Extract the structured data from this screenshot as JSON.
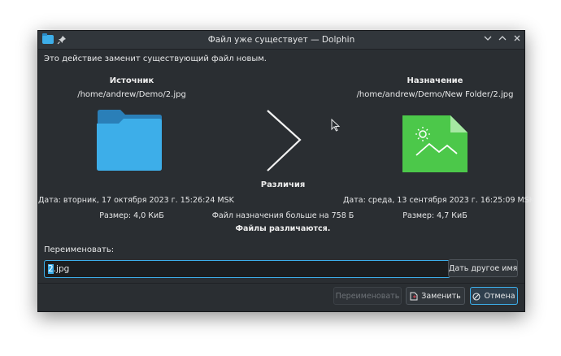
{
  "window": {
    "title": "Файл уже существует — Dolphin",
    "min_icon": "∨",
    "max_icon": "∧",
    "close_icon": "✕",
    "pin_icon": "pin-icon"
  },
  "description": "Это действие заменит существующий файл новым.",
  "source": {
    "heading": "Источник",
    "path": "/home/andrew/Demo/2.jpg",
    "date": "Дата: вторник, 17 октября 2023 г. 15:26:24 MSK",
    "size": "Размер: 4,0 КиБ"
  },
  "destination": {
    "heading": "Назначение",
    "path": "/home/andrew/Demo/New Folder/2.jpg",
    "date": "Дата: среда, 13 сентября 2023 г. 16:25:09 MSK",
    "size": "Размер: 4,7 КиБ"
  },
  "differences": {
    "heading": "Различия",
    "size_diff": "Файл назначения больше на 758 Б",
    "files_differ": "Файлы различаются."
  },
  "rename": {
    "label": "Переименовать:",
    "value_selected": "2",
    "value_rest": ".jpg",
    "suggest_button": "Дать другое имя"
  },
  "buttons": {
    "rename": "Переименовать",
    "replace": "Заменить",
    "cancel": "Отмена"
  },
  "colors": {
    "window_bg": "#2a2e32",
    "accent": "#3daee9",
    "folder": "#3daee9",
    "image_icon": "#4cc84a"
  }
}
